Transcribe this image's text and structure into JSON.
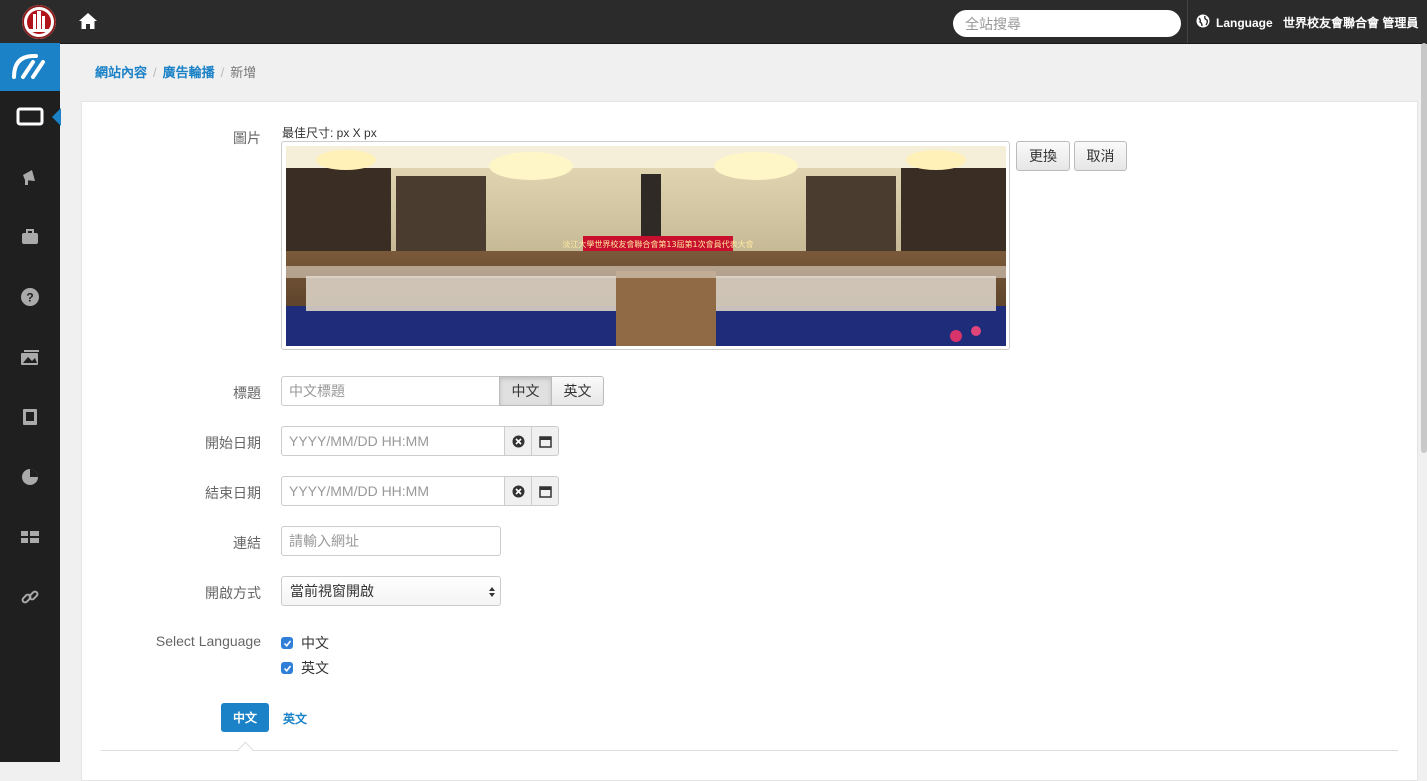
{
  "header": {
    "search_placeholder": "全站搜尋",
    "language_label": "Language",
    "user_label": "世界校友會聯合會 管理員"
  },
  "sidebar": {
    "items": [
      {
        "icon": "monitor-icon",
        "active": true
      },
      {
        "icon": "megaphone-icon"
      },
      {
        "icon": "briefcase-icon"
      },
      {
        "icon": "help-icon"
      },
      {
        "icon": "gallery-icon"
      },
      {
        "icon": "book-icon"
      },
      {
        "icon": "pie-chart-icon"
      },
      {
        "icon": "grid-icon"
      },
      {
        "icon": "link-icon"
      }
    ]
  },
  "breadcrumb": {
    "items": [
      "網站內容",
      "廣告輪播"
    ],
    "current": "新增"
  },
  "form": {
    "image_label": "圖片",
    "image_hint": "最佳尺寸: px X px",
    "banner_text": "淡江大學世界校友會聯合會第13屆第1次會員代表大會",
    "change_button": "更換",
    "cancel_button": "取消",
    "title_label": "標題",
    "title_placeholder": "中文標題",
    "title_lang_zh": "中文",
    "title_lang_en": "英文",
    "start_label": "開始日期",
    "start_placeholder": "YYYY/MM/DD HH:MM",
    "end_label": "結束日期",
    "end_placeholder": "YYYY/MM/DD HH:MM",
    "link_label": "連結",
    "link_placeholder": "請輸入網址",
    "open_label": "開啟方式",
    "open_value": "當前視窗開啟",
    "lang_label": "Select Language",
    "lang_options": [
      {
        "label": "中文",
        "checked": true
      },
      {
        "label": "英文",
        "checked": true
      }
    ],
    "tab_active": "中文",
    "tab_other": "英文"
  },
  "colors": {
    "accent": "#1b82c7",
    "topbar": "#2b2b2b",
    "sidebar": "#1f1f1f"
  }
}
